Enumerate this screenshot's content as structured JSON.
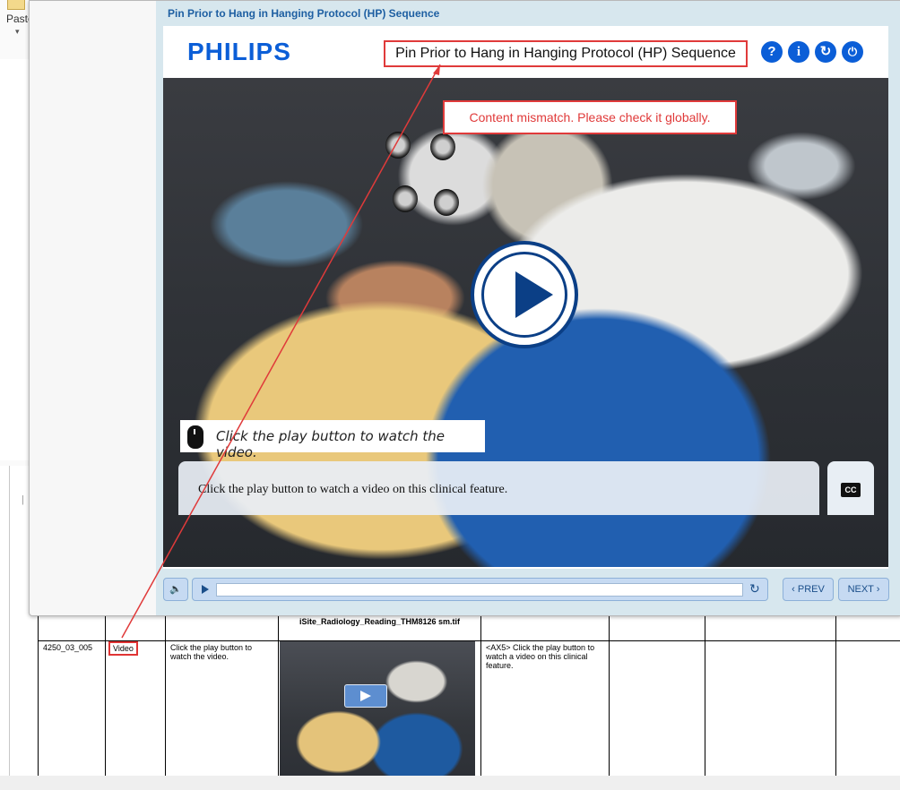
{
  "word": {
    "paste_label": "Paste",
    "paste_arrow": "▾"
  },
  "popup": {
    "window_title": "Pin Prior to Hang in Hanging Protocol (HP) Sequence",
    "brand": "PHILIPS",
    "course_title": "Pin Prior to Hang in Hanging Protocol (HP) Sequence",
    "header_buttons": [
      {
        "icon": "help-icon",
        "glyph": "?"
      },
      {
        "icon": "info-icon",
        "glyph": "i"
      },
      {
        "icon": "refresh-icon",
        "glyph": "↻"
      },
      {
        "icon": "power-icon",
        "glyph": "⏻"
      }
    ],
    "review_comment": "Content mismatch. Please check it globally.",
    "instruction": "Click the play button to watch the video.",
    "caption": "Click the play button to watch a video on this clinical feature.",
    "cc_label": "CC",
    "controls": {
      "volume_glyph": "🔈",
      "replay_glyph": "↻",
      "prev_label": "‹ PREV",
      "next_label": "NEXT ›",
      "progress": 0
    }
  },
  "table": {
    "image_filename": "iSite_Radiology_Reading_THM8126 sm.tif",
    "row": {
      "id": "4250_03_005",
      "type": "Video",
      "onscreen_text": "Click the play button to watch the video.",
      "narration": "<AX5> Click the play button to watch a video on this clinical feature."
    }
  },
  "colors": {
    "brand_blue": "#0b5ed7",
    "annotation_red": "#e03a3a",
    "title_blue": "#1e5fa2"
  }
}
